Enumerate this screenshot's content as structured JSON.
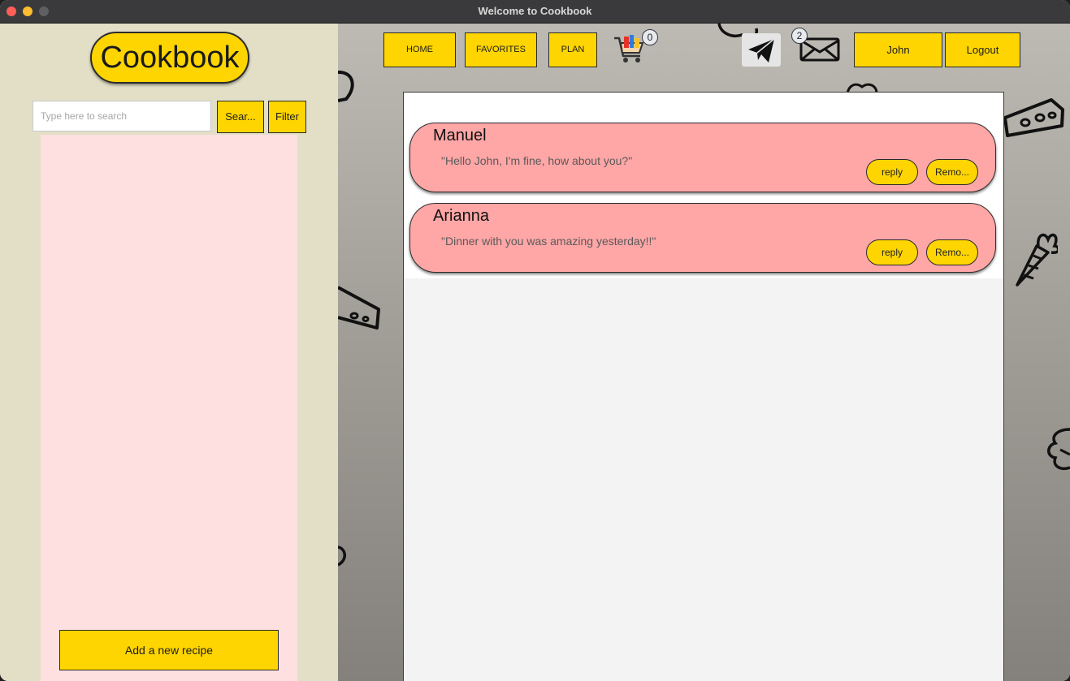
{
  "window": {
    "title": "Welcome to Cookbook"
  },
  "sidebar": {
    "logo": "Cookbook",
    "search_placeholder": "Type here to search",
    "search_button": "Sear...",
    "filter_button": "Filter",
    "add_recipe_button": "Add a new recipe"
  },
  "topbar": {
    "nav": {
      "home": "HOME",
      "favorites": "FAVORITES",
      "plan": "PLAN"
    },
    "cart_count": "0",
    "mail_count": "2",
    "user": "John",
    "logout": "Logout"
  },
  "messages": [
    {
      "sender": "Manuel",
      "text": "\"Hello John, I'm fine, how about you?\"",
      "reply": "reply",
      "remove": "Remo..."
    },
    {
      "sender": "Arianna",
      "text": "\"Dinner with you was amazing yesterday!!\"",
      "reply": "reply",
      "remove": "Remo..."
    }
  ],
  "colors": {
    "accent": "#fed500",
    "message_bg": "#ffa6a6",
    "sidebar_bg": "#e3dfc7",
    "list_bg": "#ffe0e0"
  },
  "icons": {
    "cart": "shopping-cart-icon",
    "send": "paper-plane-icon",
    "mail": "envelope-icon"
  }
}
